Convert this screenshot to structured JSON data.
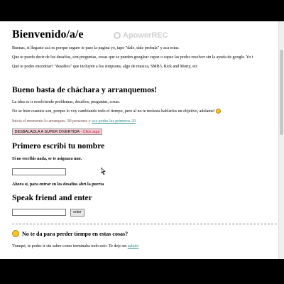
{
  "watermark": {
    "text": "ApowerREC"
  },
  "page": {
    "title": "Bienvenido/a/e",
    "intro": [
      "Buenas, si llegaste acá es porque seguro te pase la pagina yo, tapo \"dale, dale probala\" y aca estas.",
      "Que te puedo decir de los desafíos, son preguntas, cosas que se pueden googlear capaz o capaz las podes resolver sin la ayuda de google. Yo i",
      "Qué te podes encontrar? \"desafios\" que incluyen a los simpsons, algo de musica, SMB3, Rick and Morty, etc"
    ]
  },
  "section_start": {
    "heading": "Bueno basta de cháchara y arranquemos!",
    "line1": "La idea es ir resolviendo problemas, desafíos, preguntas, cosas.",
    "line2": "No se bien cuantos son, porque lo voy cambiando todo el tiempo, pero al no te molesta hablarlos un objetivo, adelante!",
    "line3_dim": "Inicia el momento lo arranques. 90 persones y",
    "line3_link": "aca podes las primeros 20",
    "super_button": {
      "main": "DESBALADLA A SUPER DIVERTIDA",
      "click": "- Click aqui"
    }
  },
  "section_name": {
    "heading": "Primero escribi tu nombre",
    "note": "Si no escribis nada, se te asignara uno.",
    "input_value": "",
    "after": "Ahora sí, para entrar en los desafíos abrí la puerta"
  },
  "section_speak": {
    "heading": "Speak friend and enter",
    "input_value": "",
    "button": "enter"
  },
  "section_time": {
    "heading": "No te da para perder tiempo en estas cosas?",
    "line": "Tranqui, te podes ir sin saber como terminaba todo esto. Te dejo un",
    "link": "saludo"
  },
  "colors": {
    "link": "#2a8a8a",
    "super_bg": "#f5cfd6",
    "accent": "#b02040"
  },
  "icons": [
    "smiley-icon",
    "cursor-icon"
  ]
}
